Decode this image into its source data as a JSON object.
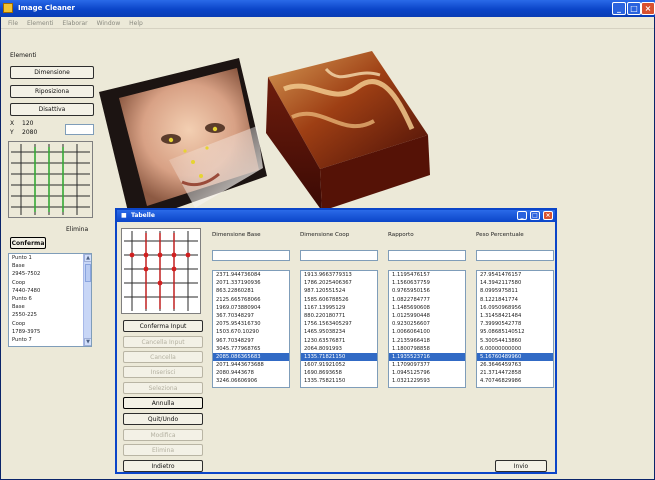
{
  "window": {
    "title": "Image Cleaner",
    "menu": [
      "File",
      "Elementi",
      "Elaborar",
      "Window",
      "Help"
    ]
  },
  "sidebar": {
    "section_label": "Elementi",
    "buttons": [
      "Dimensione",
      "Riposiziona",
      "Disattiva"
    ],
    "x_label": "X",
    "x_value": "120",
    "y_label": "Y",
    "y_value": "2080",
    "grid_caption": "Elimina",
    "list_button": "Conferma",
    "list_items": [
      "Punto 1",
      "Base",
      "2945-7502",
      "Coop",
      "7440-7480",
      "Punto 6",
      "Base",
      "2550-225",
      "Coop",
      "1789-3975",
      "Punto 7"
    ]
  },
  "dialog": {
    "title": "Tabelle",
    "left_buttons": [
      {
        "label": "Conferma Input",
        "enabled": true
      },
      {
        "label": "Cancella Input",
        "enabled": false
      },
      {
        "label": "Cancella",
        "enabled": false
      },
      {
        "label": "Inserisci",
        "enabled": false
      },
      {
        "label": "Seleziona",
        "enabled": false
      },
      {
        "label": "Annulla",
        "enabled": true
      },
      {
        "label": "Quit/Undo",
        "enabled": true
      },
      {
        "label": "Modifica",
        "enabled": false
      },
      {
        "label": "Elimina",
        "enabled": false
      },
      {
        "label": "Indietro",
        "enabled": true
      }
    ],
    "ok_label": "Invio",
    "selected_row": 10,
    "columns": [
      {
        "header": "Dimensione Base",
        "values": [
          "2371.944736084",
          "2071.337190936",
          "863.22860281",
          "2125.665768066",
          "1969.073880904",
          "367.70348297",
          "2075.954316730",
          "1503.670.10290",
          "967.70348297",
          "3045.777968765",
          "2085.086365683",
          "2071.9443673688",
          "2080.9443678",
          "3246.06606906"
        ]
      },
      {
        "header": "Dimensione Coop",
        "values": [
          "1913.9663779313",
          "1786.2025406367",
          "987.120551524",
          "1585.606788526",
          "1167.13995129",
          "880.220180771",
          "1756.1563405297",
          "1465.95038234",
          "1230.63576871",
          "2064.8091993",
          "1335.71821150",
          "1607.91921052",
          "1690.8693658",
          "1335.75821150"
        ]
      },
      {
        "header": "Rapporto",
        "values": [
          "1.1195476157",
          "1.1560637759",
          "0.9765950156",
          "1.0822784777",
          "1.1485690608",
          "1.0125990448",
          "0.9230256607",
          "1.0066064100",
          "1.2135966418",
          "1.1800798858",
          "1.1935523716",
          "1.1709097377",
          "1.0945125796",
          "1.0321229593"
        ]
      },
      {
        "header": "Peso Percentuale",
        "values": [
          "27.9541476157",
          "14.3942117580",
          "8.0995975811",
          "8.1221841774",
          "16.0950968956",
          "1.31458421484",
          "7.39990542778",
          "95.08685140512",
          "5.30054413860",
          "6.00000000000",
          "5.16760489960",
          "26.3646459763",
          "21.3714472858",
          "4.70746829986"
        ]
      }
    ]
  },
  "images": {
    "face": "face-image",
    "terrain": "terrain-image"
  }
}
